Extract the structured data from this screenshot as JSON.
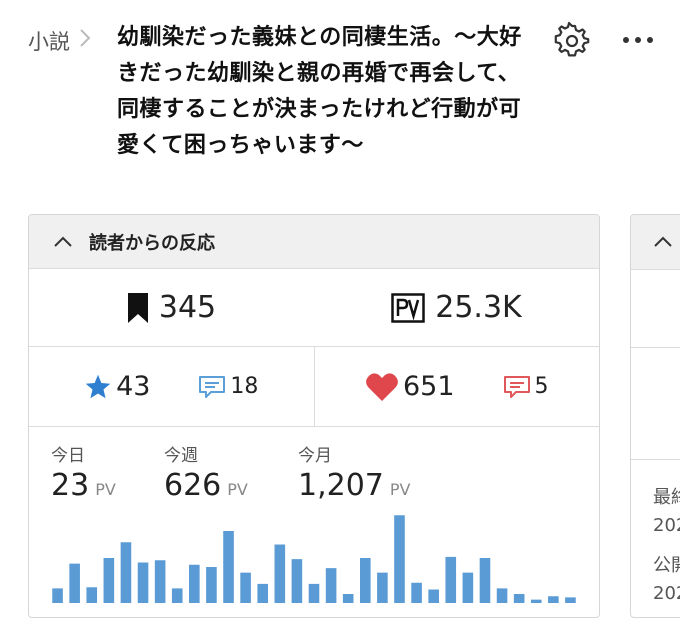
{
  "header": {
    "breadcrumb": "小説",
    "title": "幼馴染だった義妹との同棲生活。〜大好きだった幼馴染と親の再婚で再会して、同棲することが決まったけれど行動が可愛くて困っちゃいます〜",
    "icons": [
      "chevron-right-icon",
      "gear-icon",
      "more-icon"
    ]
  },
  "reactions": {
    "heading": "読者からの反応",
    "bookmarks": "345",
    "pv_total": "25.3K",
    "stars": "43",
    "star_comments": "18",
    "hearts": "651",
    "heart_comments": "5"
  },
  "pv": {
    "today_label": "今日",
    "today_value": "23",
    "week_label": "今週",
    "week_value": "626",
    "month_label": "今月",
    "month_value": "1,207",
    "unit": "PV"
  },
  "chart_data": {
    "type": "bar",
    "values": [
      13,
      35,
      14,
      40,
      54,
      36,
      38,
      13,
      34,
      32,
      64,
      27,
      17,
      52,
      39,
      17,
      31,
      8,
      40,
      27,
      78,
      18,
      12,
      41,
      27,
      40,
      13,
      8,
      3,
      6,
      5
    ],
    "color": "#5b9bd5"
  },
  "side_card": {
    "items": [
      "最終",
      "202",
      "公開",
      "202"
    ]
  },
  "colors": {
    "star": "#2f7fd1",
    "comment_blue": "#5a9fd8",
    "heart": "#e0474d",
    "comment_red": "#e0575c"
  }
}
